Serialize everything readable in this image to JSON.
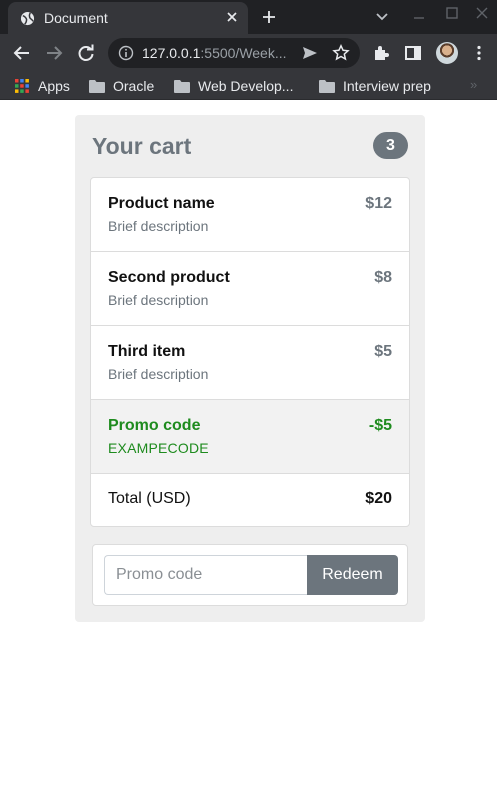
{
  "browser": {
    "tab_title": "Document",
    "url_host": "127.0.0.1",
    "url_rest": ":5500/Week...",
    "bookmarks": {
      "apps": "Apps",
      "oracle": "Oracle",
      "webdev": "Web Develop...",
      "interview": "Interview prep",
      "more": "»"
    }
  },
  "cart": {
    "title": "Your cart",
    "count": "3",
    "items": [
      {
        "name": "Product name",
        "description": "Brief description",
        "price": "$12"
      },
      {
        "name": "Second product",
        "description": "Brief description",
        "price": "$8"
      },
      {
        "name": "Third item",
        "description": "Brief description",
        "price": "$5"
      }
    ],
    "promo": {
      "label": "Promo code",
      "code": "EXAMPECODE",
      "discount": "-$5"
    },
    "total": {
      "label": "Total (USD)",
      "amount": "$20"
    }
  },
  "promo_form": {
    "placeholder": "Promo code",
    "value": "",
    "button_label": "Redeem"
  },
  "colors": {
    "accent_gray": "#6c757d",
    "promo_green": "#1e8b1e",
    "chrome_dark": "#202124",
    "chrome_toolbar": "#35363a"
  }
}
